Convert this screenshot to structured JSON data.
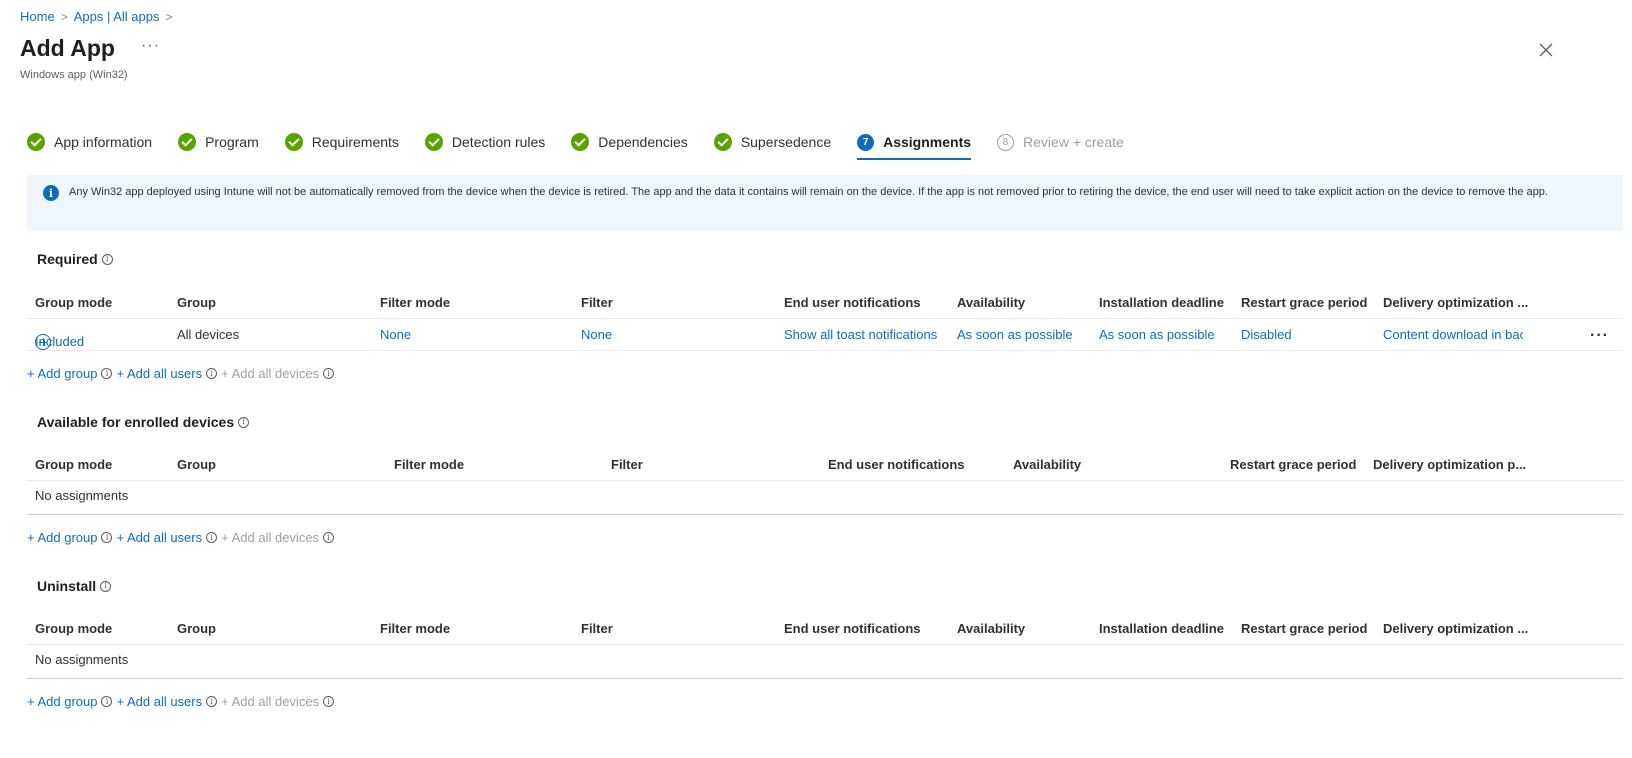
{
  "breadcrumb": {
    "home": "Home",
    "apps": "Apps | All apps",
    "sep": ">"
  },
  "header": {
    "title": "Add App",
    "more": "···",
    "subtitle": "Windows app (Win32)"
  },
  "wizard": {
    "steps": [
      {
        "label": "App information",
        "state": "complete"
      },
      {
        "label": "Program",
        "state": "complete"
      },
      {
        "label": "Requirements",
        "state": "complete"
      },
      {
        "label": "Detection rules",
        "state": "complete"
      },
      {
        "label": "Dependencies",
        "state": "complete"
      },
      {
        "label": "Supersedence",
        "state": "complete"
      },
      {
        "label": "Assignments",
        "state": "active",
        "num": "7"
      },
      {
        "label": "Review + create",
        "state": "disabled",
        "num": "8"
      }
    ]
  },
  "banner": {
    "text": "Any Win32 app deployed using Intune will not be automatically removed from the device when the device is retired. The app and the data it contains will remain on the device. If the app is not removed prior to retiring the device, the end user will need to take explicit action on the device to remove the app."
  },
  "required": {
    "title": "Required",
    "headers": [
      "Group mode",
      "Group",
      "Filter mode",
      "Filter",
      "End user notifications",
      "Availability",
      "Installation deadline",
      "Restart grace period",
      "Delivery optimization ..."
    ],
    "row": {
      "group_mode": "Included",
      "group": "All devices",
      "filter_mode": "None",
      "filter": "None",
      "notifications": "Show all toast notifications",
      "availability": "As soon as possible",
      "deadline": "As soon as possible",
      "restart": "Disabled",
      "delivery": "Content download in background",
      "more": "···"
    }
  },
  "available": {
    "title": "Available for enrolled devices",
    "headers": [
      "Group mode",
      "Group",
      "Filter mode",
      "Filter",
      "End user notifications",
      "Availability",
      "Restart grace period",
      "Delivery optimization p..."
    ],
    "empty": "No assignments"
  },
  "uninstall": {
    "title": "Uninstall",
    "headers": [
      "Group mode",
      "Group",
      "Filter mode",
      "Filter",
      "End user notifications",
      "Availability",
      "Installation deadline",
      "Restart grace period",
      "Delivery optimization ..."
    ],
    "empty": "No assignments"
  },
  "actions": {
    "add_group": "+ Add group",
    "add_all_users": "+ Add all users",
    "add_all_devices": "+ Add all devices",
    "info": "i"
  },
  "colors": {
    "accent": "#0f6cbd",
    "success": "#57a300",
    "banner_bg": "#eff6fc"
  }
}
